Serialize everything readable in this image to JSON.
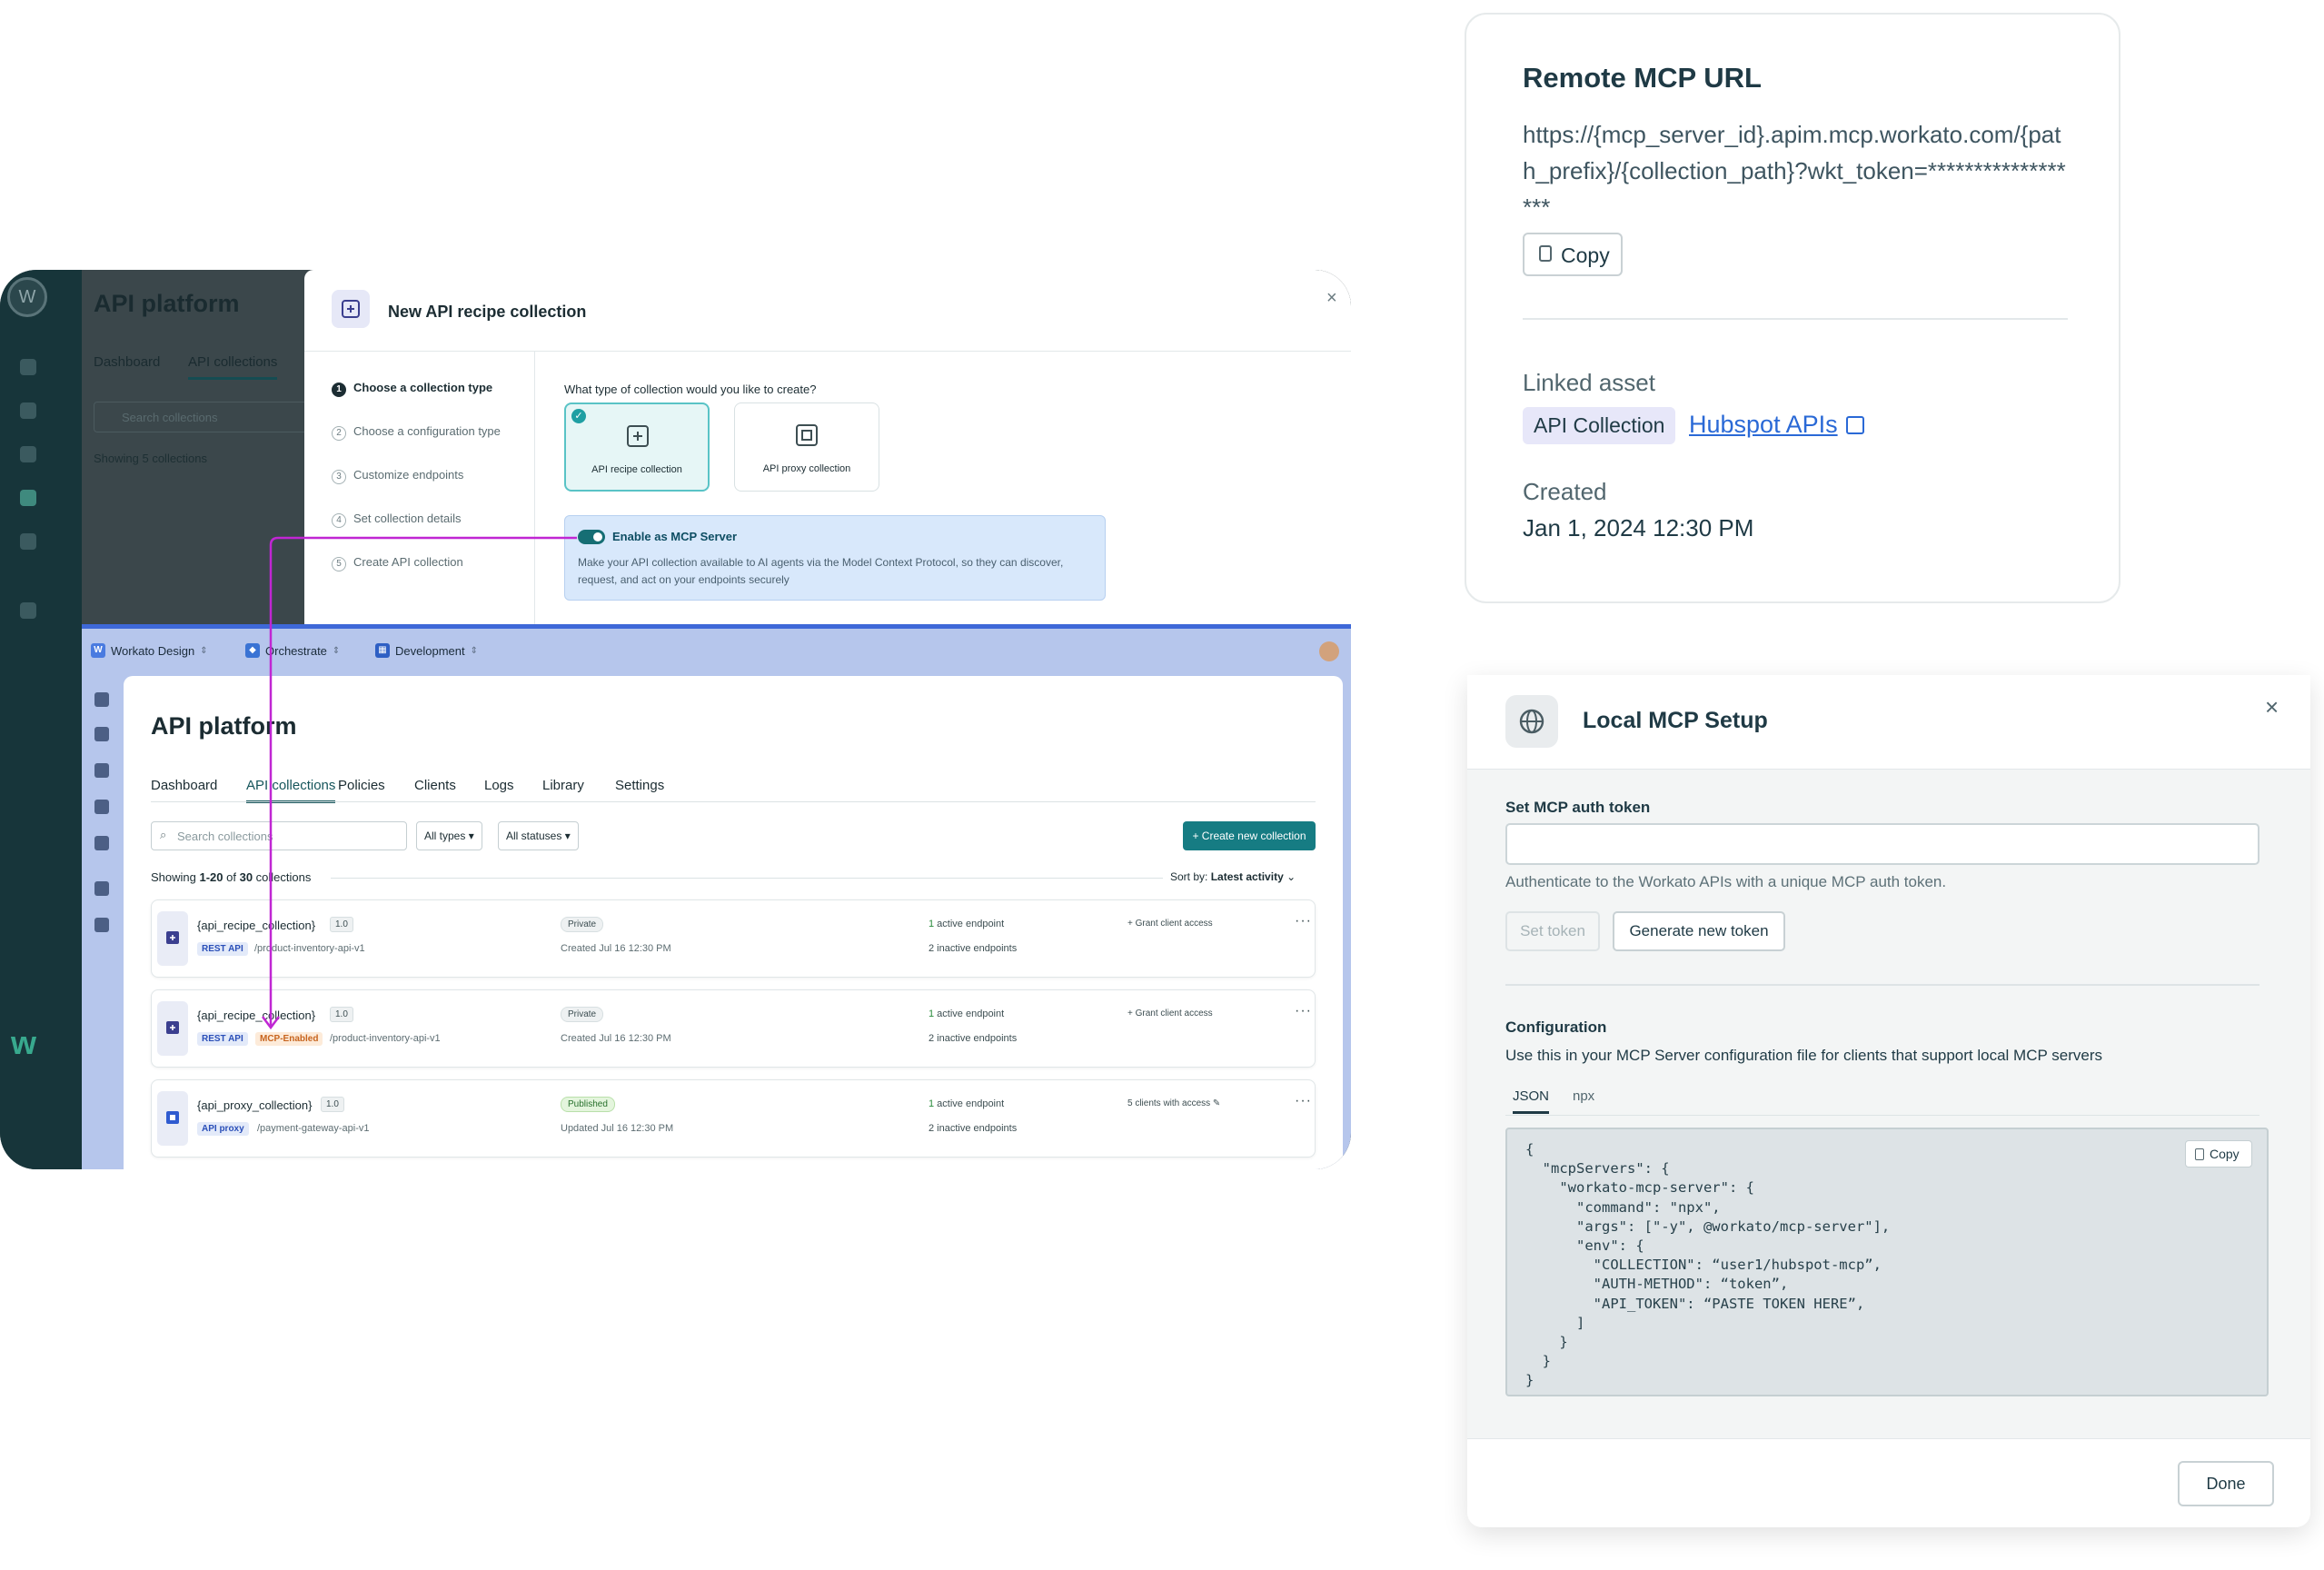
{
  "background_app": {
    "title": "API platform",
    "tabs": [
      "Dashboard",
      "API collections"
    ],
    "search_placeholder": "Search collections",
    "showing": "Showing 5 collections"
  },
  "modal": {
    "title": "New API recipe collection",
    "close_glyph": "×",
    "steps": [
      {
        "num": "1",
        "label": "Choose a collection type"
      },
      {
        "num": "2",
        "label": "Choose a configuration type"
      },
      {
        "num": "3",
        "label": "Customize endpoints"
      },
      {
        "num": "4",
        "label": "Set collection details"
      },
      {
        "num": "5",
        "label": "Create API collection"
      }
    ],
    "question": "What type of collection would you like to create?",
    "options": [
      "API recipe collection",
      "API proxy collection"
    ],
    "mcp_toggle_label": "Enable as MCP Server",
    "mcp_toggle_desc": "Make your API collection available to AI agents via the Model Context Protocol, so they can discover, request, and act on your endpoints securely"
  },
  "app": {
    "breadcrumbs": [
      "Workato Design",
      "Orchestrate",
      "Development"
    ],
    "title": "API platform",
    "tabs": [
      "Dashboard",
      "API collections",
      "Policies",
      "Clients",
      "Logs",
      "Library",
      "Settings"
    ],
    "search_placeholder": "Search collections",
    "filters": [
      "All types",
      "All statuses"
    ],
    "create_button": "+ Create new collection",
    "showing_prefix": "Showing ",
    "showing_range": "1-20",
    "showing_mid": " of ",
    "showing_total": "30",
    "showing_suffix": " collections",
    "sort_label": "Sort by:",
    "sort_value": "Latest activity",
    "rows": [
      {
        "name": "{api_recipe_collection}",
        "version": "1.0",
        "kind": "REST API",
        "mcp": "",
        "path": "/product-inventory-api-v1",
        "status": "Private",
        "date": "Created Jul 16 12:30 PM",
        "active_count": "1",
        "active_text": " active endpoint",
        "inactive": "2 inactive endpoints",
        "access": "+ Grant client access"
      },
      {
        "name": "{api_recipe_collection}",
        "version": "1.0",
        "kind": "REST API",
        "mcp": "MCP-Enabled",
        "path": "/product-inventory-api-v1",
        "status": "Private",
        "date": "Created Jul 16 12:30 PM",
        "active_count": "1",
        "active_text": " active endpoint",
        "inactive": "2 inactive endpoints",
        "access": "+ Grant client access"
      },
      {
        "name": "{api_proxy_collection}",
        "version": "1.0",
        "kind": "API proxy",
        "mcp": "",
        "path": "/payment-gateway-api-v1",
        "status": "Published",
        "date": "Updated Jul 16 12:30 PM",
        "active_count": "1",
        "active_text": " active endpoint",
        "inactive": "2 inactive endpoints",
        "access": "5 clients with access ✎"
      }
    ]
  },
  "remote": {
    "title": "Remote MCP URL",
    "url": "https://{mcp_server_id}.apim.mcp.workato.com/{path_prefix}/{collection_path}?wkt_token=******************",
    "copy_label": "Copy",
    "linked_label": "Linked asset",
    "linked_badge": "API Collection",
    "linked_link": "Hubspot APIs",
    "created_label": "Created",
    "created_value": "Jan 1, 2024 12:30 PM"
  },
  "local": {
    "title": "Local MCP Setup",
    "close_glyph": "×",
    "auth_label": "Set MCP auth token",
    "auth_value": "",
    "auth_help": "Authenticate to the Workato APIs with a unique MCP auth token.",
    "set_token": "Set token",
    "generate_token": "Generate new token",
    "config_label": "Configuration",
    "config_help": "Use this in your MCP Server configuration file for clients that support local MCP servers",
    "tabs": [
      "JSON",
      "npx"
    ],
    "code_copy": "Copy",
    "code_lines": [
      "{",
      "  \"mcpServers\": {",
      "    \"workato-mcp-server\": {",
      "      \"command\": \"npx\",",
      "      \"args\": [\"-y\", @workato/mcp-server\"],",
      "      \"env\": {",
      "        \"COLLECTION\": “user1/hubspot-mcp”,",
      "        \"AUTH-METHOD\": “token”,",
      "        \"API_TOKEN\": “PASTE TOKEN HERE”,",
      "      ]",
      "    }",
      "  }",
      "}"
    ],
    "done": "Done"
  },
  "colors": {
    "accent": "#167c83",
    "connector": "#c026d3",
    "mcp_box": "#d8e8fb",
    "link": "#2a69d6"
  }
}
